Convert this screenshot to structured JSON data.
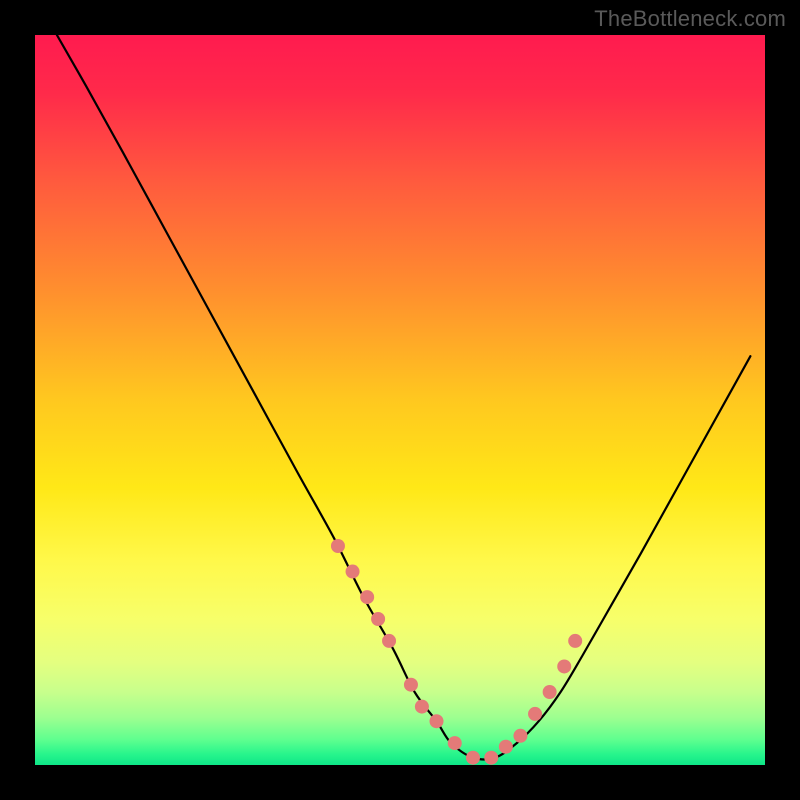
{
  "watermark": "TheBottleneck.com",
  "chart_data": {
    "type": "line",
    "title": "",
    "xlabel": "",
    "ylabel": "",
    "xlim": [
      0,
      100
    ],
    "ylim": [
      0,
      100
    ],
    "grid": false,
    "legend": false,
    "series": [
      {
        "name": "curve",
        "x": [
          3,
          7,
          12,
          18,
          24,
          30,
          36,
          41,
          45,
          49,
          52,
          55,
          57,
          60,
          63,
          66,
          69,
          72,
          75,
          79,
          83,
          88,
          93,
          98
        ],
        "y": [
          100,
          93,
          84,
          73,
          62,
          51,
          40,
          31,
          23,
          16,
          10,
          6,
          3,
          1,
          1,
          3,
          6,
          10,
          15,
          22,
          29,
          38,
          47,
          56
        ]
      }
    ],
    "markers": {
      "name": "dots",
      "color": "#e47a78",
      "x": [
        41.5,
        43.5,
        45.5,
        47.0,
        48.5,
        51.5,
        53.0,
        55.0,
        57.5,
        60.0,
        62.5,
        64.5,
        66.5,
        68.5,
        70.5,
        72.5,
        74.0
      ],
      "y": [
        30.0,
        26.5,
        23.0,
        20.0,
        17.0,
        11.0,
        8.0,
        6.0,
        3.0,
        1.0,
        1.0,
        2.5,
        4.0,
        7.0,
        10.0,
        13.5,
        17.0
      ]
    },
    "gradient_stops": [
      {
        "offset": 0.0,
        "color": "#ff1b4f"
      },
      {
        "offset": 0.08,
        "color": "#ff2a4a"
      },
      {
        "offset": 0.2,
        "color": "#ff5a3e"
      },
      {
        "offset": 0.35,
        "color": "#ff8f2e"
      },
      {
        "offset": 0.5,
        "color": "#ffc81f"
      },
      {
        "offset": 0.62,
        "color": "#ffe817"
      },
      {
        "offset": 0.72,
        "color": "#fff84a"
      },
      {
        "offset": 0.8,
        "color": "#f7ff6a"
      },
      {
        "offset": 0.86,
        "color": "#e4ff80"
      },
      {
        "offset": 0.9,
        "color": "#c8ff8c"
      },
      {
        "offset": 0.935,
        "color": "#9dff90"
      },
      {
        "offset": 0.965,
        "color": "#5fff8f"
      },
      {
        "offset": 0.985,
        "color": "#28f58c"
      },
      {
        "offset": 1.0,
        "color": "#0ee688"
      }
    ]
  }
}
